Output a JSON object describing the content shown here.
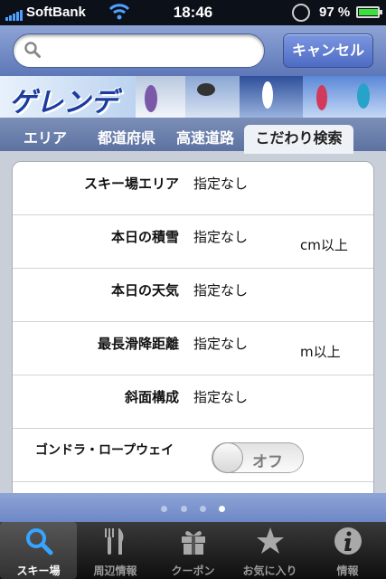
{
  "status": {
    "carrier": "SoftBank",
    "time": "18:46",
    "battery": "97 %",
    "battery_level": 0.97
  },
  "search": {
    "placeholder": "",
    "cancel_label": "キャンセル"
  },
  "banner": {
    "title": "ゲレンデ"
  },
  "tabs": [
    {
      "label": "エリア"
    },
    {
      "label": "都道府県"
    },
    {
      "label": "高速道路"
    },
    {
      "label": "こだわり検索"
    }
  ],
  "filters": [
    {
      "label": "スキー場エリア",
      "value": "指定なし",
      "unit": ""
    },
    {
      "label": "本日の積雪",
      "value": "指定なし",
      "unit": "cm以上"
    },
    {
      "label": "本日の天気",
      "value": "指定なし",
      "unit": ""
    },
    {
      "label": "最長滑降距離",
      "value": "指定なし",
      "unit": "m以上"
    },
    {
      "label": "斜面構成",
      "value": "指定なし",
      "unit": ""
    }
  ],
  "gondola": {
    "label": "ゴンドラ・ロープウェイ",
    "toggle": "オフ"
  },
  "pager": {
    "pages": 4,
    "current": 4
  },
  "tabbar": [
    {
      "label": "スキー場",
      "icon": "search-icon"
    },
    {
      "label": "周辺情報",
      "icon": "fork-knife-icon"
    },
    {
      "label": "クーポン",
      "icon": "gift-icon"
    },
    {
      "label": "お気に入り",
      "icon": "star-icon"
    },
    {
      "label": "情報",
      "icon": "info-icon"
    }
  ]
}
